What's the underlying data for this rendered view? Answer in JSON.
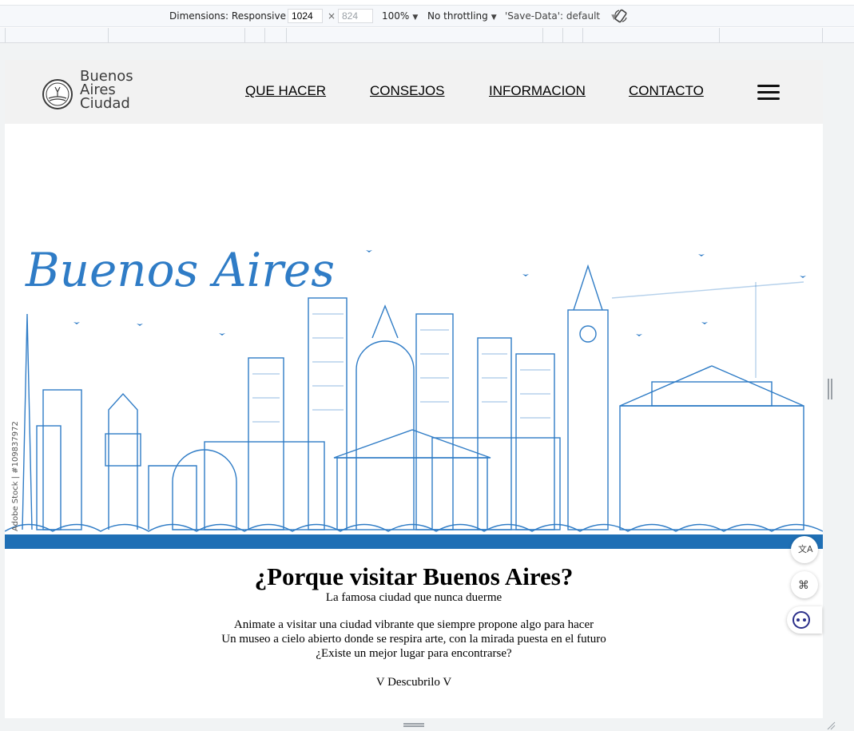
{
  "devtools": {
    "dimensions_label": "Dimensions: Responsive",
    "width_value": "1024",
    "times": "×",
    "height_value": "824",
    "zoom": "100%",
    "throttling": "No throttling",
    "save_data": "'Save-Data': default"
  },
  "site": {
    "logo": {
      "line1": "Buenos",
      "line2": "Aires",
      "line3": "Ciudad"
    },
    "nav": [
      "QUE HACER",
      "CONSEJOS",
      "INFORMACION",
      "CONTACTO"
    ],
    "hero": {
      "script_title": "Buenos Aires",
      "watermark": "Adobe Stock | #109837972"
    },
    "main": {
      "heading": "¿Porque visitar Buenos Aires?",
      "subheading": "La famosa ciudad que nunca duerme",
      "lines": [
        "Animate a visitar una ciudad vibrante que siempre propone algo para hacer",
        "Un museo a cielo abierto donde se respira arte, con la mirada puesta en el futuro",
        "¿Existe un mejor lugar para encontrarse?"
      ],
      "cta": "V Descubrilo V"
    }
  },
  "colors": {
    "skyline_blue": "#2f7cc6",
    "band_blue": "#1f6fb5",
    "header_bg": "#f2f2f2"
  },
  "icons": [
    "rotate-icon",
    "city-emblem-icon",
    "hamburger-menu-icon",
    "translate-icon",
    "command-icon",
    "assistant-face-icon"
  ]
}
